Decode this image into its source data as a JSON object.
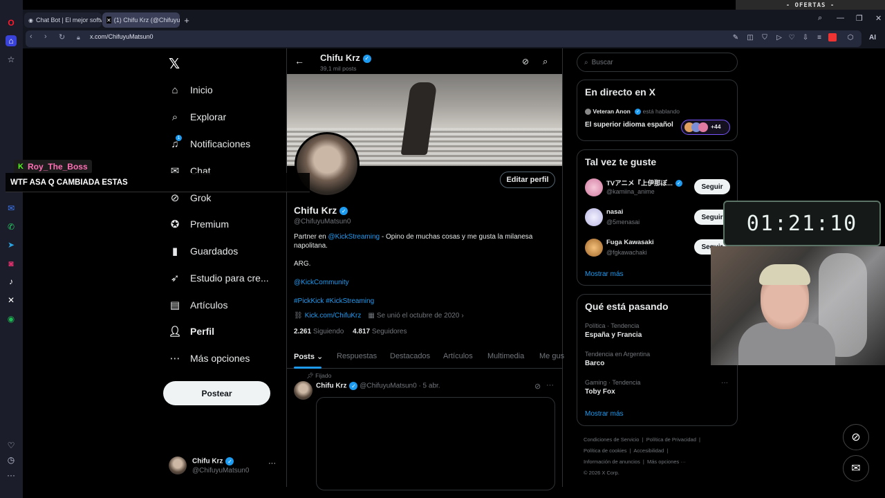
{
  "browser": {
    "tabs": [
      {
        "title": "Chat Bot | El mejor softwa",
        "active": false
      },
      {
        "title": "(1) Chifu Krz (@ChifuyuMa",
        "active": true
      }
    ],
    "new_tab_icon": "plus-icon",
    "url": "x.com/ChifuyuMatsun0",
    "ai_label": "AI",
    "offer_bar": "- OFERTAS -",
    "sidebar_icons": [
      "opera-logo-icon",
      "home-icon",
      "star-icon",
      "kick-icon",
      "messenger-icon",
      "whatsapp-icon",
      "telegram-icon",
      "instagram-icon",
      "tiktok-icon",
      "x-icon",
      "spotify-icon",
      "heart-icon",
      "history-icon",
      "more-icon"
    ]
  },
  "x_nav": {
    "logo": "𝕏",
    "items": [
      {
        "label": "Inicio",
        "icon": "home-icon"
      },
      {
        "label": "Explorar",
        "icon": "search-icon"
      },
      {
        "label": "Notificaciones",
        "icon": "bell-icon",
        "badge": "1"
      },
      {
        "label": "Chat",
        "icon": "chat-icon"
      },
      {
        "label": "Grok",
        "icon": "grok-icon"
      },
      {
        "label": "Premium",
        "icon": "premium-icon"
      },
      {
        "label": "Guardados",
        "icon": "bookmark-icon"
      },
      {
        "label": "Estudio para cre...",
        "icon": "rocket-icon"
      },
      {
        "label": "Artículos",
        "icon": "article-icon"
      },
      {
        "label": "Perfil",
        "icon": "person-icon"
      },
      {
        "label": "Más opciones",
        "icon": "more-circle-icon"
      }
    ],
    "post_label": "Postear",
    "account": {
      "name": "Chifu Krz",
      "handle": "@ChifuyuMatsun0",
      "more": "···"
    }
  },
  "profile": {
    "header_name": "Chifu Krz",
    "post_count": "39,1 mil posts",
    "edit_label": "Editar perfil",
    "name": "Chifu Krz",
    "handle": "@ChifuyuMatsun0",
    "bio_prefix": "Partner en ",
    "bio_mention": "@KickStreaming",
    "bio_rest": " - Opino de muchas cosas y me gusta la milanesa napolitana.",
    "line_arg": "ARG.",
    "mention_community": "@KickCommunity",
    "hashtags": "#PickKick #KickStreaming",
    "website": "Kick.com/ChifuKrz",
    "joined": "Se unió el octubre de 2020",
    "following_count": "2.261",
    "following_label": "Siguiendo",
    "followers_count": "4.817",
    "followers_label": "Seguidores",
    "tabs": [
      "Posts",
      "Respuestas",
      "Destacados",
      "Artículos",
      "Multimedia",
      "Me gus"
    ],
    "pinned": {
      "label": "Fijado",
      "name": "Chifu Krz",
      "handle": "@ChifuyuMatsun0",
      "date": "· 5 abr.",
      "more": "···"
    }
  },
  "right": {
    "search_placeholder": "Buscar",
    "live": {
      "title": "En directo en X",
      "host": "Veteran Anon",
      "host_suffix": "está hablando",
      "topic": "El superior idioma español",
      "listeners": "+44"
    },
    "suggest": {
      "title": "Tal vez te guste",
      "users": [
        {
          "name": "TVアニメ『上伊那ぼ...",
          "handle": "@kamiina_anime",
          "verified": true,
          "btn": "Seguir"
        },
        {
          "name": "nasai",
          "handle": "@5menasai",
          "verified": false,
          "btn": "Seguir"
        },
        {
          "name": "Fuga Kawasaki",
          "handle": "@fgkawachaki",
          "verified": false,
          "btn": "Seguir"
        }
      ],
      "more": "Mostrar más"
    },
    "trends": {
      "title": "Qué está pasando",
      "items": [
        {
          "context": "Política · Tendencia",
          "name": "España y Francia"
        },
        {
          "context": "Tendencia en Argentina",
          "name": "Barco"
        },
        {
          "context": "Gaming · Tendencia",
          "name": "Toby Fox",
          "more": "···"
        }
      ],
      "more": "Mostrar más"
    },
    "footer": {
      "l1": "Condiciones de Servicio",
      "l2": "Política de Privacidad",
      "l3": "Política de cookies",
      "l4": "Accesibilidad",
      "l5": "Información de anuncios",
      "l6": "Más opciones ···",
      "l7": "© 2026 X Corp."
    }
  },
  "overlay": {
    "chat_user": "Roy_The_Boss",
    "chat_message": "WTF ASA Q CAMBIADA ESTAS",
    "timer": "01:21:10"
  },
  "colors": {
    "accent": "#1d9bf0",
    "kick_green": "#53fc18",
    "chat_pink": "#ff6fb5"
  }
}
